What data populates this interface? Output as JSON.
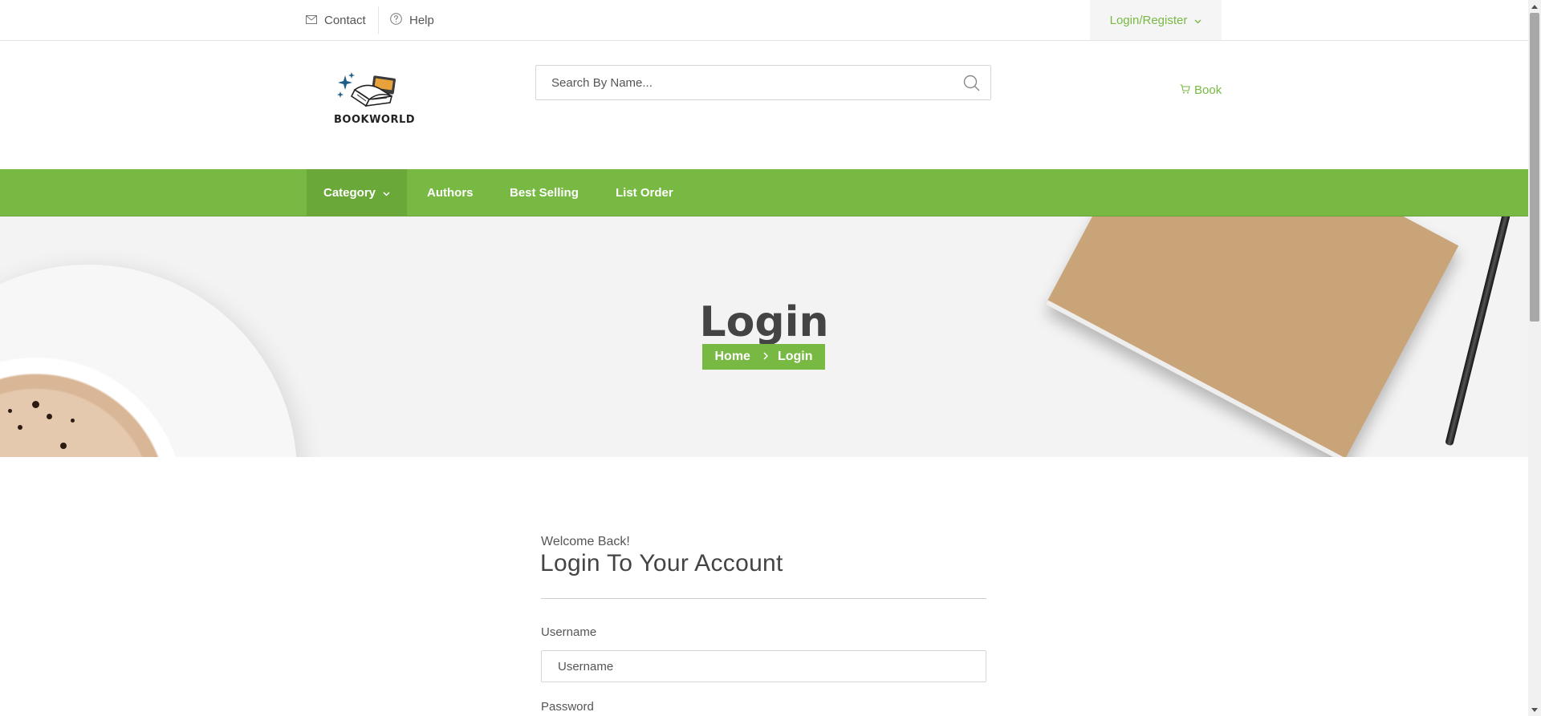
{
  "topbar": {
    "contact_label": "Contact",
    "help_label": "Help",
    "login_register_label": "Login/Register"
  },
  "header": {
    "logo_text": "BOOKWORLD",
    "search_placeholder": "Search By Name...",
    "cart_label": "Book"
  },
  "nav": {
    "items": [
      {
        "label": "Category"
      },
      {
        "label": "Authors"
      },
      {
        "label": "Best Selling"
      },
      {
        "label": "List Order"
      }
    ]
  },
  "hero": {
    "title": "Login",
    "breadcrumb": {
      "home": "Home",
      "current": "Login"
    }
  },
  "login_form": {
    "welcome": "Welcome Back!",
    "title": "Login To Your Account",
    "username_label": "Username",
    "username_placeholder": "Username",
    "password_label": "Password"
  },
  "colors": {
    "accent": "#78b944",
    "nav_active": "#6aa83a",
    "text_dark": "#444444"
  }
}
